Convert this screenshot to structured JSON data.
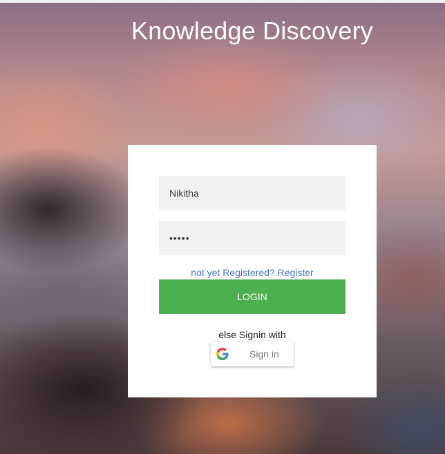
{
  "app": {
    "title": "Knowledge Discovery"
  },
  "login_form": {
    "username_value": "Nikitha",
    "password_value": "•••••",
    "register_link": "not yet Registered? Register",
    "login_button": "LOGIN",
    "alt_signin_text": "else Signin with",
    "google_button": {
      "label": "Sign in",
      "icon": "google-icon"
    }
  },
  "colors": {
    "login_button": "#4caf50",
    "link": "#4b77be",
    "input_background": "#f2f2f2"
  }
}
